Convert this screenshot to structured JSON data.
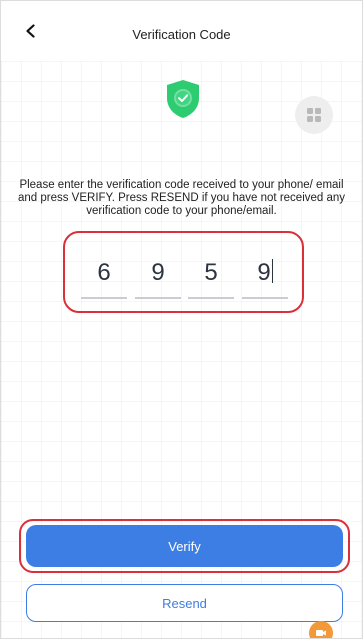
{
  "header": {
    "title": "Verification Code",
    "back_icon": "chevron-left-icon"
  },
  "icons": {
    "shield": "shield-check-icon",
    "grid": "grid-icon",
    "floating": "video-camera-icon"
  },
  "instructions": "Please enter the verification code received to your phone/ email and press VERIFY. Press RESEND if you have not received any verification code to your phone/email.",
  "code": {
    "digits": [
      "6",
      "9",
      "5",
      "9"
    ]
  },
  "buttons": {
    "verify_label": "Verify",
    "resend_label": "Resend"
  },
  "colors": {
    "primary": "#3c7ee4",
    "shield_green": "#2ecc71",
    "highlight_red": "#d9303a",
    "floating_orange": "#f29a3a"
  }
}
